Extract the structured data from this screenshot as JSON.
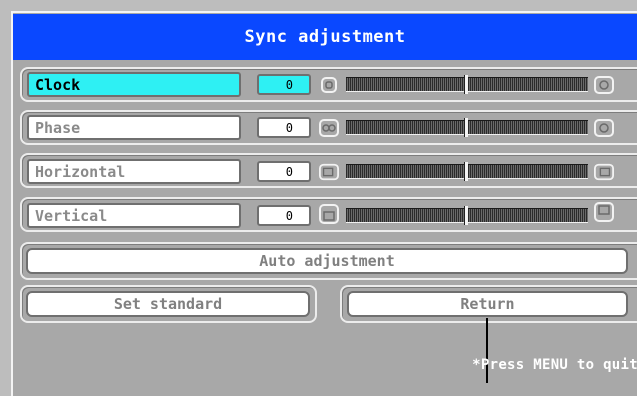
{
  "title": "Sync adjustment",
  "rows": [
    {
      "label": "Clock",
      "value": "0",
      "selected": true,
      "icon_left": "clock-low-icon",
      "icon_right": "clock-high-icon"
    },
    {
      "label": "Phase",
      "value": "0",
      "selected": false,
      "icon_left": "phase-low-icon",
      "icon_right": "phase-high-icon"
    },
    {
      "label": "Horizontal",
      "value": "0",
      "selected": false,
      "icon_left": "move-left-icon",
      "icon_right": "move-right-icon"
    },
    {
      "label": "Vertical",
      "value": "0",
      "selected": false,
      "icon_left": "move-down-icon",
      "icon_right": "move-up-icon"
    }
  ],
  "buttons": {
    "auto_adjustment": "Auto adjustment",
    "set_standard": "Set standard",
    "return": "Return"
  },
  "hint": "*Press MENU to quit",
  "colors": {
    "title_bg": "#0a48ff",
    "selected_bg": "#2ef0f3",
    "panel_bg": "#a8a8a8"
  }
}
